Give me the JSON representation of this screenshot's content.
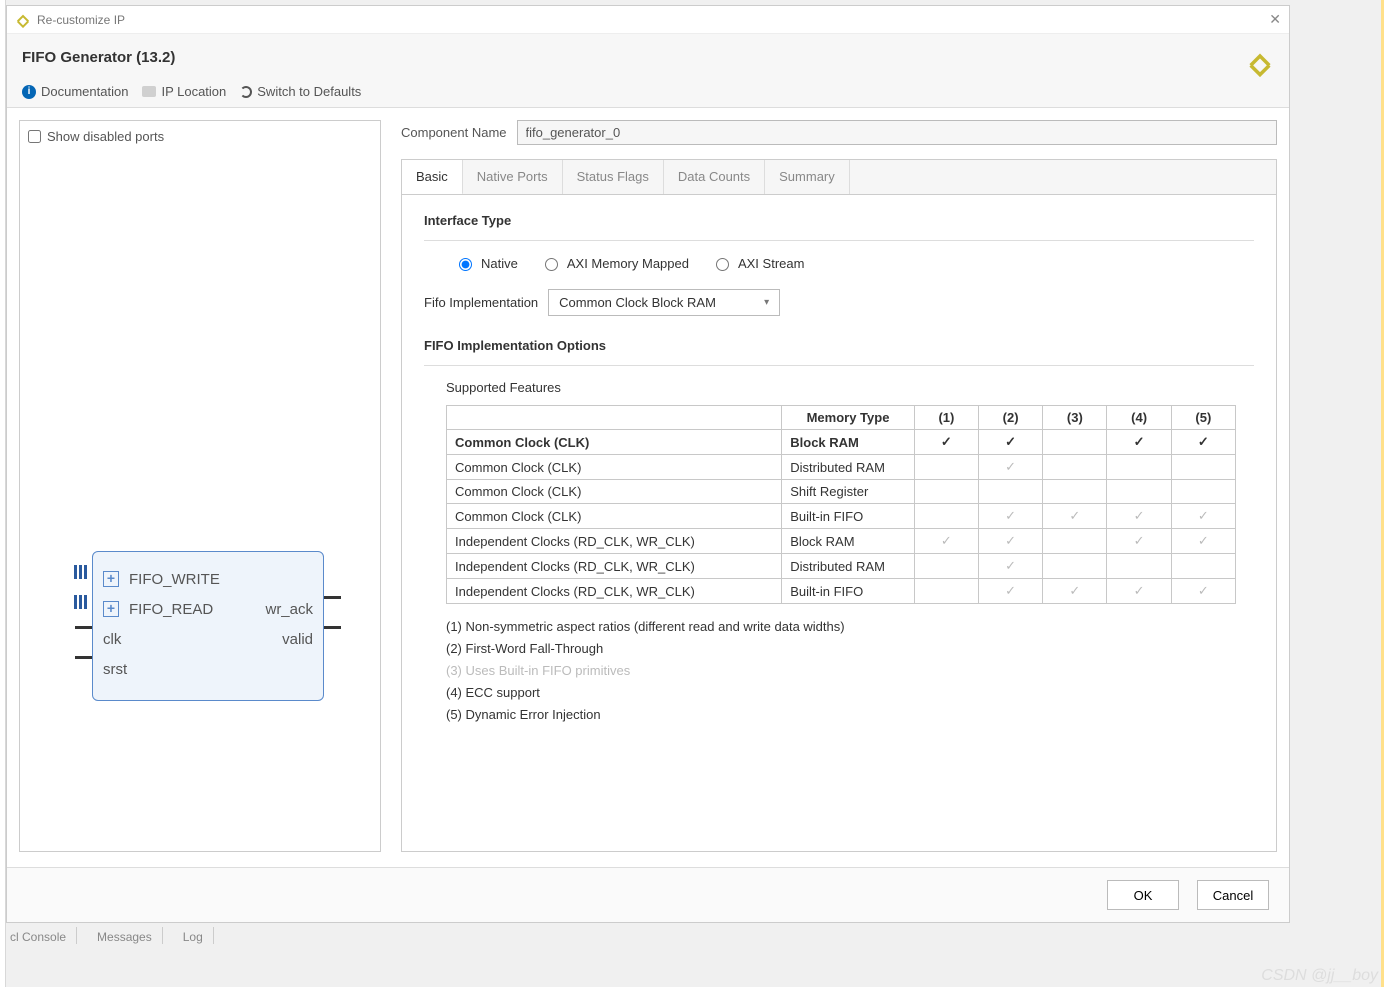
{
  "window": {
    "title": "Re-customize IP",
    "ip_title": "FIFO Generator (13.2)"
  },
  "toolbar": {
    "documentation": "Documentation",
    "ip_location": "IP Location",
    "switch_defaults": "Switch to Defaults"
  },
  "left": {
    "show_disabled_ports": "Show disabled ports",
    "ports": {
      "fifo_write": "FIFO_WRITE",
      "fifo_read": "FIFO_READ",
      "clk": "clk",
      "srst": "srst",
      "wr_ack": "wr_ack",
      "valid": "valid"
    }
  },
  "comp": {
    "label": "Component Name",
    "value": "fifo_generator_0"
  },
  "tabs": {
    "basic": "Basic",
    "native_ports": "Native Ports",
    "status_flags": "Status Flags",
    "data_counts": "Data Counts",
    "summary": "Summary"
  },
  "basic": {
    "interface_type_label": "Interface Type",
    "radio_native": "Native",
    "radio_axi_mm": "AXI Memory Mapped",
    "radio_axi_stream": "AXI Stream",
    "fifo_impl_label": "Fifo Implementation",
    "fifo_impl_value": "Common Clock Block RAM",
    "options_label": "FIFO Implementation Options",
    "supported_features": "Supported Features",
    "th_memtype": "Memory Type",
    "th_c1": "(1)",
    "th_c2": "(2)",
    "th_c3": "(3)",
    "th_c4": "(4)",
    "th_c5": "(5)",
    "rows": [
      {
        "impl": "Common Clock (CLK)",
        "mem": "Block RAM",
        "c1": "b",
        "c2": "b",
        "c3": "",
        "c4": "b",
        "c5": "b"
      },
      {
        "impl": "Common Clock (CLK)",
        "mem": "Distributed RAM",
        "c1": "",
        "c2": "g",
        "c3": "",
        "c4": "",
        "c5": ""
      },
      {
        "impl": "Common Clock (CLK)",
        "mem": "Shift Register",
        "c1": "",
        "c2": "",
        "c3": "",
        "c4": "",
        "c5": ""
      },
      {
        "impl": "Common Clock (CLK)",
        "mem": "Built-in FIFO",
        "c1": "",
        "c2": "g",
        "c3": "g",
        "c4": "g",
        "c5": "g"
      },
      {
        "impl": "Independent Clocks (RD_CLK, WR_CLK)",
        "mem": "Block RAM",
        "c1": "g",
        "c2": "g",
        "c3": "",
        "c4": "g",
        "c5": "g"
      },
      {
        "impl": "Independent Clocks (RD_CLK, WR_CLK)",
        "mem": "Distributed RAM",
        "c1": "",
        "c2": "g",
        "c3": "",
        "c4": "",
        "c5": ""
      },
      {
        "impl": "Independent Clocks (RD_CLK, WR_CLK)",
        "mem": "Built-in FIFO",
        "c1": "",
        "c2": "g",
        "c3": "g",
        "c4": "g",
        "c5": "g"
      }
    ],
    "note1": "(1) Non-symmetric aspect ratios (different read and write data widths)",
    "note2": "(2) First-Word Fall-Through",
    "note3": "(3) Uses Built-in FIFO primitives",
    "note4": "(4) ECC support",
    "note5": "(5) Dynamic Error Injection"
  },
  "footer": {
    "ok": "OK",
    "cancel": "Cancel"
  },
  "statusbar": {
    "console": "cl Console",
    "messages": "Messages",
    "log": "Log"
  },
  "watermark": "CSDN @jj__boy"
}
